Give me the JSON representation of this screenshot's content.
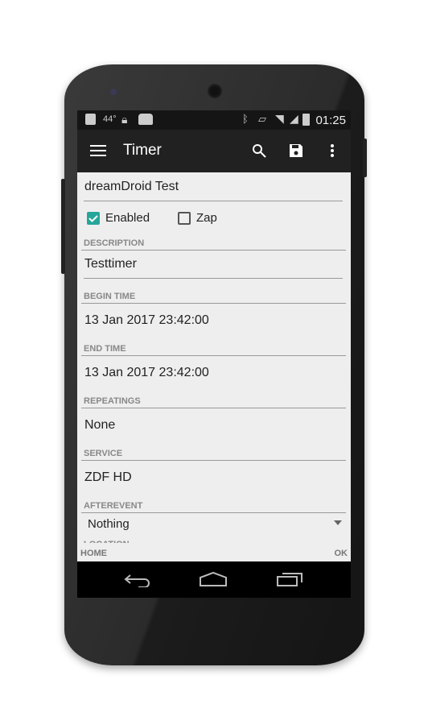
{
  "status_bar": {
    "temperature": "44°",
    "time": "01:25"
  },
  "action_bar": {
    "title": "Timer",
    "icons": [
      "menu-icon",
      "search-icon",
      "save-icon",
      "more-vert-icon"
    ]
  },
  "form": {
    "name": "dreamDroid Test",
    "enabled": {
      "label": "Enabled",
      "checked": true
    },
    "zap": {
      "label": "Zap",
      "checked": false
    },
    "description": {
      "label": "DESCRIPTION",
      "value": "Testtimer"
    },
    "begin": {
      "label": "BEGIN TIME",
      "value": "13 Jan 2017 23:42:00"
    },
    "end": {
      "label": "END TIME",
      "value": "13 Jan 2017 23:42:00"
    },
    "repeatings": {
      "label": "REPEATINGS",
      "value": "None"
    },
    "service": {
      "label": "SERVICE",
      "value": "ZDF HD"
    },
    "afterevent": {
      "label": "AFTEREVENT",
      "value": "Nothing"
    },
    "location": {
      "label": "LOCATION"
    }
  },
  "bottom": {
    "home": "HOME",
    "ok": "OK"
  },
  "colors": {
    "accent": "#26a69a",
    "actionbar": "#212121",
    "background": "#eeeeee"
  }
}
